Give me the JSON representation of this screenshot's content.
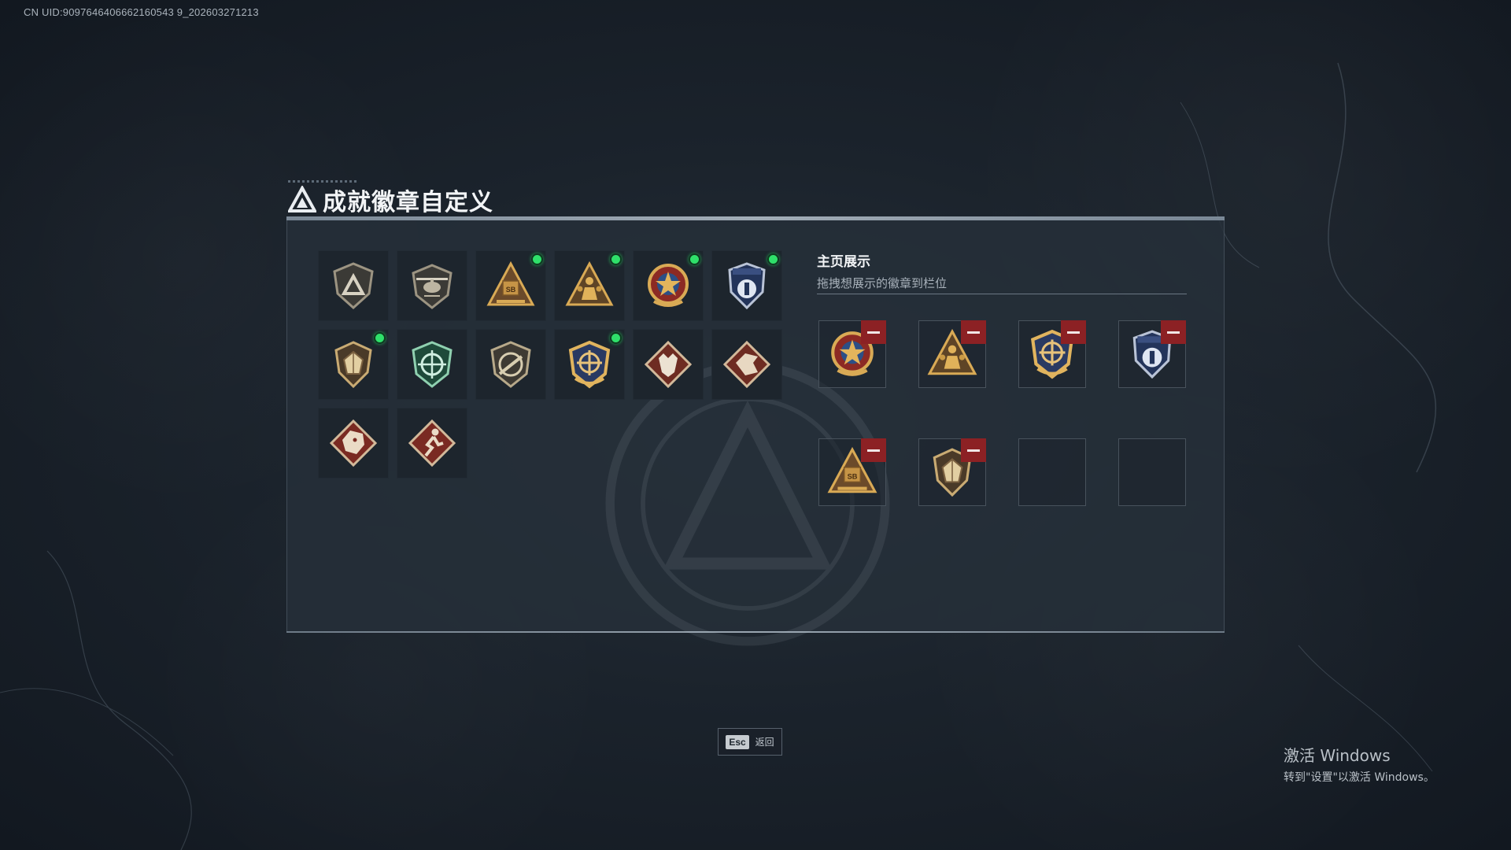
{
  "uid_text": "CN UID:9097646406662160543 9_202603271213",
  "header": {
    "title": "成就徽章自定义"
  },
  "badges": [
    {
      "icon": "shield-triangle-icon",
      "new": false
    },
    {
      "icon": "helicopter-badge-icon",
      "new": false
    },
    {
      "icon": "sb-triangle-badge-icon",
      "new": true
    },
    {
      "icon": "soldiers-triangle-badge-icon",
      "new": true
    },
    {
      "icon": "star-medal-badge-icon",
      "new": true
    },
    {
      "icon": "blue-shield-badge-icon",
      "new": true
    },
    {
      "icon": "gem-shield-badge-icon",
      "new": true
    },
    {
      "icon": "green-crosshair-badge-icon",
      "new": false
    },
    {
      "icon": "rifle-shield-badge-icon",
      "new": false
    },
    {
      "icon": "gold-crosshair-badge-icon",
      "new": true
    },
    {
      "icon": "wolf-diamond-badge-icon",
      "new": false
    },
    {
      "icon": "dragon-diamond-badge-icon",
      "new": false
    },
    {
      "icon": "dragon-red-diamond-badge-icon",
      "new": false
    },
    {
      "icon": "runner-diamond-badge-icon",
      "new": false
    }
  ],
  "showcase": {
    "title": "主页展示",
    "subtitle": "拖拽想展示的徽章到栏位",
    "slots": [
      {
        "icon": "star-medal-badge-icon",
        "filled": true
      },
      {
        "icon": "soldiers-triangle-badge-icon",
        "filled": true
      },
      {
        "icon": "gold-crosshair-badge-icon",
        "filled": true
      },
      {
        "icon": "blue-shield-badge-icon",
        "filled": true
      },
      {
        "icon": "sb-triangle-badge-icon",
        "filled": true
      },
      {
        "icon": "gem-shield-badge-icon",
        "filled": true
      },
      {
        "icon": "",
        "filled": false
      },
      {
        "icon": "",
        "filled": false
      }
    ]
  },
  "footer": {
    "esc_key": "Esc",
    "esc_label": "返回"
  },
  "activation": {
    "line1": "激活 Windows",
    "line2": "转到\"设置\"以激活 Windows。"
  },
  "colors": {
    "new_dot": "#2fe06a",
    "remove": "#8c2124",
    "panel": "#262f39"
  }
}
